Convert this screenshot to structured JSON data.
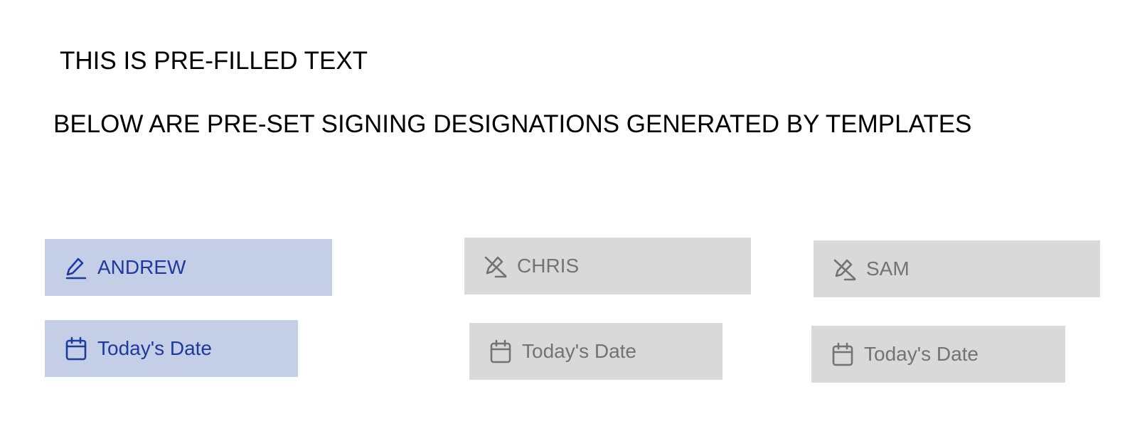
{
  "document": {
    "prefilled_text": "THIS IS PRE-FILLED TEXT",
    "designations_heading": "BELOW ARE PRE-SET SIGNING DESIGNATIONS GENERATED BY TEMPLATES"
  },
  "colors": {
    "active_background": "#c5cee7",
    "active_text": "#1d3a9c",
    "inactive_background": "#d9d9d9",
    "inactive_text": "#737373"
  },
  "signers": [
    {
      "name": "ANDREW",
      "state": "active",
      "signature_icon": "pen-icon",
      "date_label": "Today's Date",
      "date_icon": "calendar-icon"
    },
    {
      "name": "CHRIS",
      "state": "inactive",
      "signature_icon": "pen-off-icon",
      "date_label": "Today's Date",
      "date_icon": "calendar-icon"
    },
    {
      "name": "SAM",
      "state": "inactive",
      "signature_icon": "pen-off-icon",
      "date_label": "Today's Date",
      "date_icon": "calendar-icon"
    }
  ]
}
